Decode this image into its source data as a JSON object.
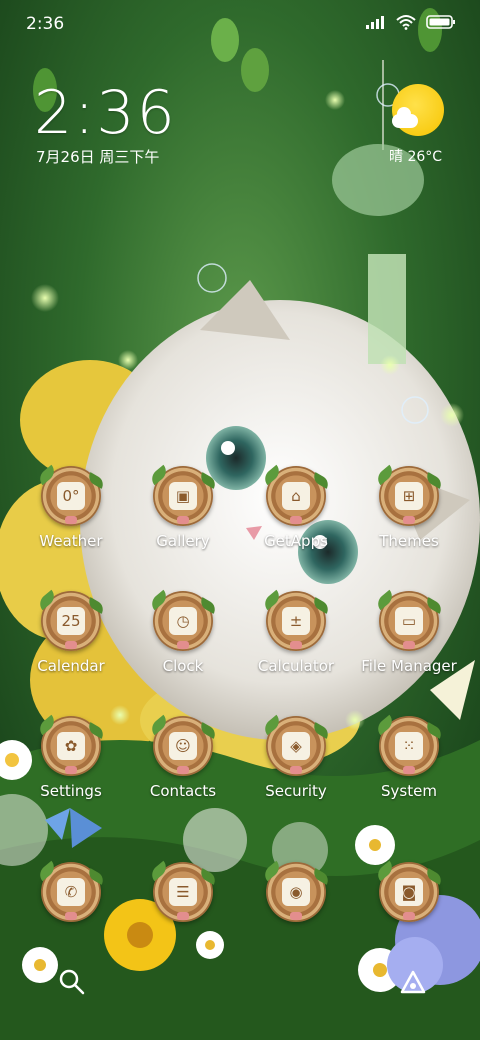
{
  "status_bar": {
    "time": "2:36",
    "icons": [
      "signal-icon",
      "wifi-icon",
      "battery-icon"
    ]
  },
  "clock_widget": {
    "time": "2:36",
    "date": "7月26日 周三下午",
    "weather": "晴 26°C",
    "weather_icon": "sunny-cloud-icon"
  },
  "home_apps": [
    {
      "label": "Weather",
      "icon": "cloud-icon",
      "glyph": "0°"
    },
    {
      "label": "Gallery",
      "icon": "picture-icon",
      "glyph": "▣"
    },
    {
      "label": "GetApps",
      "icon": "store-icon",
      "glyph": "⌂"
    },
    {
      "label": "Themes",
      "icon": "gift-icon",
      "glyph": "⊞"
    },
    {
      "label": "Calendar",
      "icon": "calendar-icon",
      "glyph": "25"
    },
    {
      "label": "Clock",
      "icon": "clock-icon",
      "glyph": "◷"
    },
    {
      "label": "Calculator",
      "icon": "calculator-icon",
      "glyph": "±"
    },
    {
      "label": "File Manager",
      "icon": "folder-icon",
      "glyph": "▭"
    },
    {
      "label": "Settings",
      "icon": "gear-icon",
      "glyph": "✿"
    },
    {
      "label": "Contacts",
      "icon": "contact-card-icon",
      "glyph": "☺"
    },
    {
      "label": "Security",
      "icon": "shield-icon",
      "glyph": "◈"
    },
    {
      "label": "System",
      "icon": "app-folder-icon",
      "glyph": "⁙"
    }
  ],
  "dock_apps": [
    {
      "icon": "phone-icon",
      "glyph": "✆"
    },
    {
      "icon": "message-icon",
      "glyph": "☰"
    },
    {
      "icon": "browser-icon",
      "glyph": "◉"
    },
    {
      "icon": "camera-icon",
      "glyph": "◙"
    }
  ],
  "dock_actions": {
    "search_icon": "search-icon",
    "assistant_icon": "assistant-icon"
  },
  "colors": {
    "wallpaper_top": "#1e4b1f",
    "wallpaper_mid": "#3f7a35",
    "icon_wood": "#a8713f",
    "icon_leaf": "#5c9b3c",
    "sun": "#f6c400"
  }
}
